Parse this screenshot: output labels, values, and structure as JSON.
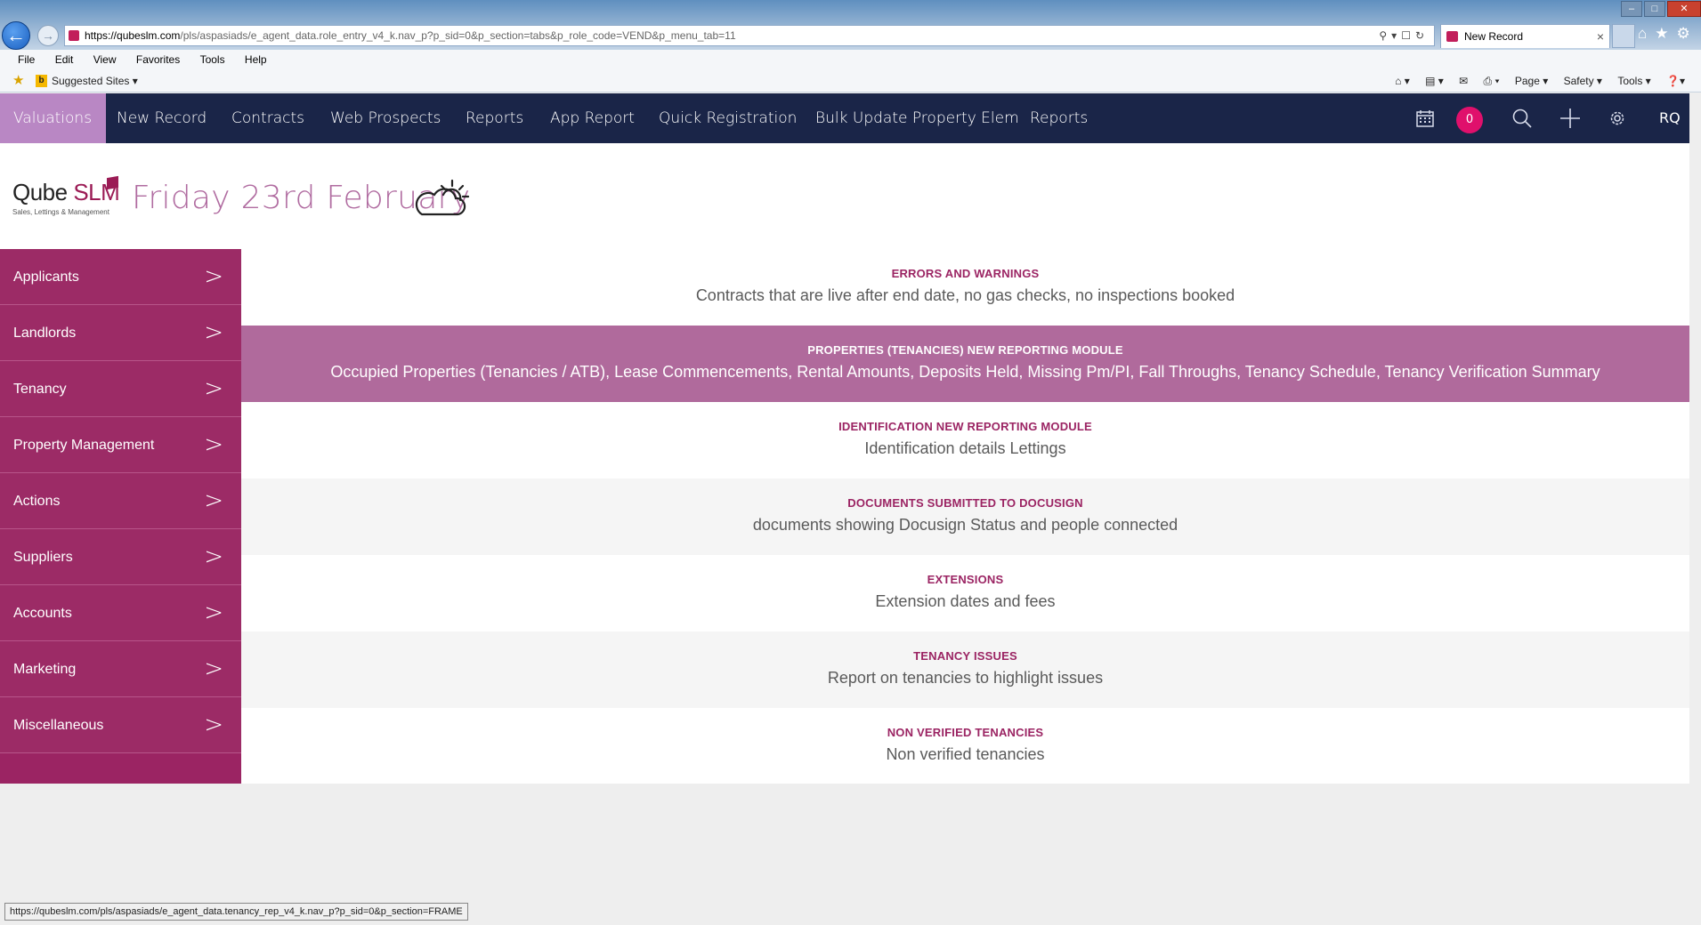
{
  "browser": {
    "url_domain": "https://qubeslm.com",
    "url_rest": "/pls/aspasiads/e_agent_data.role_entry_v4_k.nav_p?p_sid=0&p_section=tabs&p_role_code=VEND&p_menu_tab=11",
    "tab_title": "New Record",
    "menu": [
      "File",
      "Edit",
      "View",
      "Favorites",
      "Tools",
      "Help"
    ],
    "favorites_label": "Suggested Sites ▾",
    "command_bar": [
      "Page ▾",
      "Safety ▾",
      "Tools ▾"
    ],
    "status_url": "https://qubeslm.com/pls/aspasiads/e_agent_data.tenancy_rep_v4_k.nav_p?p_sid=0&p_section=FRAME"
  },
  "nav": {
    "items": [
      "Valuations",
      "New Record",
      "Contracts",
      "Web Prospects",
      "Reports",
      "App Report",
      "Quick Registration",
      "Bulk Update Property Elem",
      "Reports"
    ],
    "active": "Valuations",
    "notification_count": "0",
    "user_initials": "RQ",
    "bg_color": "#1a2548",
    "active_color": "#b987c4"
  },
  "header": {
    "logo_text_1": "Qube ",
    "logo_text_2": "SLM",
    "logo_subtitle": "Sales, Lettings & Management",
    "date": "Friday 23rd February",
    "weather_icon": "partly-cloudy-icon"
  },
  "sidebar": {
    "items": [
      "Applicants",
      "Landlords",
      "Tenancy",
      "Property Management",
      "Actions",
      "Suppliers",
      "Accounts",
      "Marketing",
      "Miscellaneous"
    ],
    "color": "#9b2463"
  },
  "reports": [
    {
      "title": "ERRORS AND WARNINGS",
      "desc": "Contracts that are live after end date, no gas checks, no inspections booked"
    },
    {
      "title": "PROPERTIES (TENANCIES) NEW REPORTING MODULE",
      "desc": "Occupied Properties (Tenancies / ATB), Lease Commencements, Rental Amounts, Deposits Held, Missing Pm/PI, Fall Throughs, Tenancy Schedule, Tenancy Verification Summary"
    },
    {
      "title": "IDENTIFICATION NEW REPORTING MODULE",
      "desc": "Identification details Lettings"
    },
    {
      "title": "DOCUMENTS SUBMITTED TO DOCUSIGN",
      "desc": "documents showing Docusign Status and people connected"
    },
    {
      "title": "EXTENSIONS",
      "desc": "Extension dates and fees"
    },
    {
      "title": "TENANCY ISSUES",
      "desc": "Report on tenancies to highlight issues"
    },
    {
      "title": "NON VERIFIED TENANCIES",
      "desc": "Non verified tenancies"
    }
  ]
}
